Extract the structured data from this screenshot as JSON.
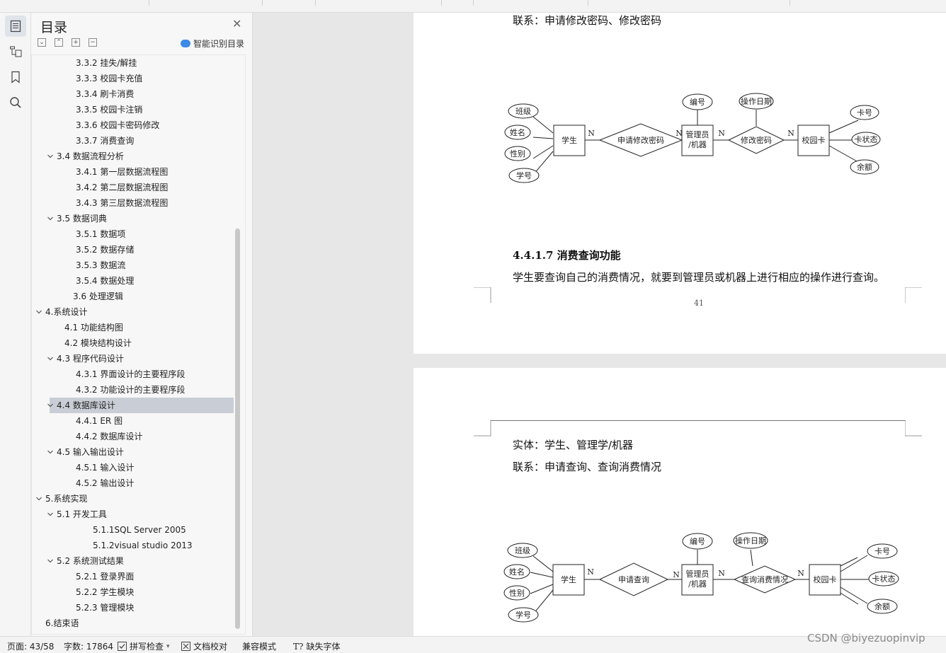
{
  "toc": {
    "title": "目录",
    "smart_label": "智能识别目录",
    "items": [
      {
        "label": "3.3.2 挂失/解挂",
        "level": 3,
        "exp": ""
      },
      {
        "label": "3.3.3 校园卡充值",
        "level": 3,
        "exp": ""
      },
      {
        "label": "3.3.4 刷卡消费",
        "level": 3,
        "exp": ""
      },
      {
        "label": "3.3.5 校园卡注销",
        "level": 3,
        "exp": ""
      },
      {
        "label": "3.3.6 校园卡密码修改",
        "level": 3,
        "exp": ""
      },
      {
        "label": "3.3.7 消费查询",
        "level": 3,
        "exp": ""
      },
      {
        "label": "3.4 数据流程分析",
        "level": 2,
        "exp": "v"
      },
      {
        "label": "3.4.1 第一层数据流程图",
        "level": 3,
        "exp": ""
      },
      {
        "label": "3.4.2 第二层数据流程图",
        "level": 3,
        "exp": ""
      },
      {
        "label": "3.4.3 第三层数据流程图",
        "level": 3,
        "exp": ""
      },
      {
        "label": "3.5 数据词典",
        "level": 2,
        "exp": "v"
      },
      {
        "label": "3.5.1 数据项",
        "level": 3,
        "exp": ""
      },
      {
        "label": "3.5.2 数据存储",
        "level": 3,
        "exp": ""
      },
      {
        "label": "3.5.3  数据流",
        "level": 3,
        "exp": ""
      },
      {
        "label": "3.5.4 数据处理",
        "level": 3,
        "exp": ""
      },
      {
        "label": "3.6 处理逻辑",
        "level": 2.8,
        "exp": ""
      },
      {
        "label": "4.系统设计",
        "level": 1,
        "exp": "v"
      },
      {
        "label": "4.1 功能结构图",
        "level": 2.2,
        "exp": ""
      },
      {
        "label": "4.2 模块结构设计",
        "level": 2.2,
        "exp": ""
      },
      {
        "label": "4.3 程序代码设计",
        "level": 2,
        "exp": "v"
      },
      {
        "label": "4.3.1 界面设计的主要程序段",
        "level": 3,
        "exp": ""
      },
      {
        "label": "4.3.2 功能设计的主要程序段",
        "level": 3,
        "exp": ""
      },
      {
        "label": "4.4 数据库设计",
        "level": 2,
        "exp": "v",
        "selected": true
      },
      {
        "label": "4.4.1 ER 图",
        "level": 3,
        "exp": ""
      },
      {
        "label": "4.4.2 数据库设计",
        "level": 3,
        "exp": ""
      },
      {
        "label": "4.5 输入输出设计",
        "level": 2,
        "exp": "v"
      },
      {
        "label": "4.5.1 输入设计",
        "level": 3,
        "exp": ""
      },
      {
        "label": "4.5.2 输出设计",
        "level": 3,
        "exp": ""
      },
      {
        "label": "5.系统实现",
        "level": 1,
        "exp": "v"
      },
      {
        "label": "5.1 开发工具",
        "level": 2,
        "exp": "v"
      },
      {
        "label": "5.1.1SQL Server 2005",
        "level": 4,
        "exp": ""
      },
      {
        "label": "5.1.2visual studio 2013",
        "level": 4,
        "exp": ""
      },
      {
        "label": "5.2 系统测试结果",
        "level": 2,
        "exp": "v"
      },
      {
        "label": "5.2.1 登录界面",
        "level": 3,
        "exp": ""
      },
      {
        "label": "5.2.2 学生模块",
        "level": 3,
        "exp": ""
      },
      {
        "label": "5.2.3 管理模块",
        "level": 3,
        "exp": ""
      },
      {
        "label": "6.结束语",
        "level": 1,
        "exp": ""
      }
    ]
  },
  "page1": {
    "relation_top": "联系：申请修改密码、修改密码",
    "heading": "4.4.1.7 消费查询功能",
    "body": "学生要查询自己的消费情况，就要到管理员或机器上进行相应的操作进行查询。",
    "page_number": "41"
  },
  "page2": {
    "entity": "实体：学生、管理学/机器",
    "relation": "联系：申请查询、查询消费情况"
  },
  "erd1": {
    "attrs_left": [
      "班级",
      "姓名",
      "性别",
      "学号"
    ],
    "student": "学生",
    "rel1": "申请修改密码",
    "admin_l1": "管理员",
    "admin_l2": "/机器",
    "admin_attr": "编号",
    "rel2": "修改密码",
    "rel2_attr": "操作日期",
    "card": "校园卡",
    "card_attrs": [
      "卡号",
      "卡状态",
      "余额"
    ],
    "n": "N"
  },
  "erd2": {
    "attrs_left": [
      "班级",
      "姓名",
      "性别",
      "学号"
    ],
    "student": "学生",
    "rel1": "申请查询",
    "admin_l1": "管理员",
    "admin_l2": "/机器",
    "admin_attr": "编号",
    "rel2": "查询消费情况",
    "rel2_attr": "操作日期",
    "card": "校园卡",
    "card_attrs": [
      "卡号",
      "卡状态",
      "余额"
    ],
    "n": "N"
  },
  "status": {
    "page": "页面: 43/58",
    "words": "字数: 17864",
    "spell": "拼写检查",
    "proof": "文档校对",
    "compat": "兼容模式",
    "missing_font": "缺失字体"
  },
  "watermark": "CSDN @biyezuopinvip"
}
